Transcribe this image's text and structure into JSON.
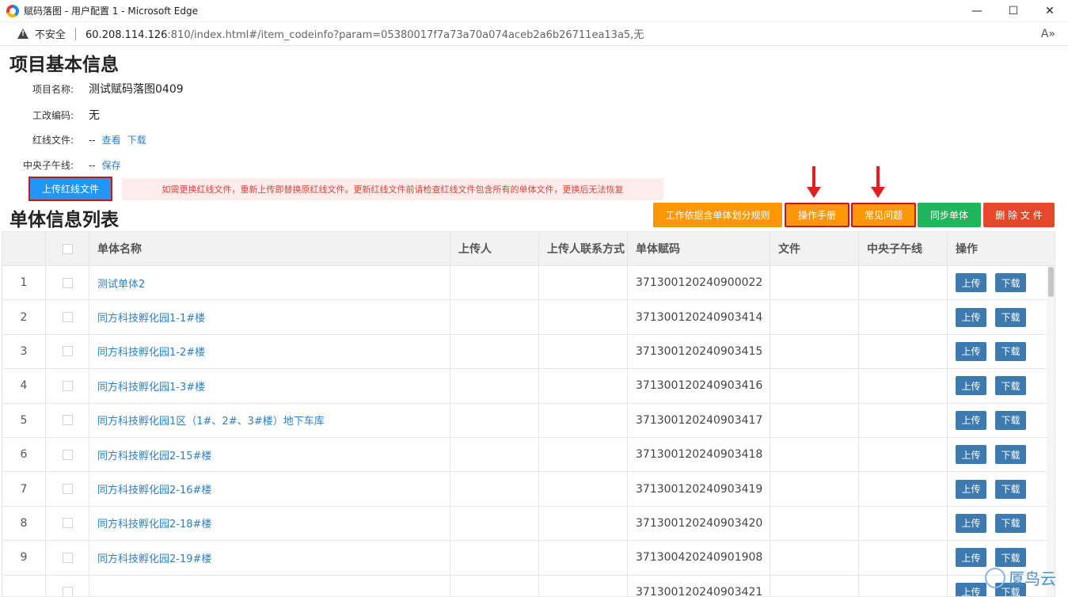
{
  "window": {
    "title": "赋码落图 - 用户配置 1 - Microsoft Edge",
    "minimize": "—",
    "maximize": "☐",
    "close": "✕"
  },
  "address": {
    "insecure_label": "不安全",
    "url_host": "60.208.114.126",
    "url_rest": ":810/index.html#/item_codeinfo?param=05380017f7a73a70a074aceb2a6b26711ea13a5,无",
    "reader_icon": "A»"
  },
  "project": {
    "heading": "项目基本信息",
    "name_label": "项目名称:",
    "name_value": "测试赋码落图0409",
    "code_label": "工改编码:",
    "code_value": "无",
    "redline_label": "红线文件:",
    "redline_dash": "--",
    "view_link": "查看",
    "download_link": "下载",
    "meridian_label": "中央子午线:",
    "meridian_dash": "--",
    "save_link": "保存",
    "upload_redline_label": "上传红线文件",
    "notice_text": "如需更换红线文件，重新上传即替换原红线文件。更新红线文件前请检查红线文件包含所有的单体文件，更换后无法恢复"
  },
  "list": {
    "heading": "单体信息列表",
    "buttons": {
      "rule": "工作依据含单体划分规则",
      "manual": "操作手册",
      "faq": "常见问题",
      "sync": "同步单体",
      "delete": "删 除 文 件"
    },
    "columns": [
      "单体名称",
      "上传人",
      "上传人联系方式",
      "单体赋码",
      "文件",
      "中央子午线",
      "操作"
    ],
    "upload_btn": "上传",
    "download_btn": "下载",
    "rows": [
      {
        "idx": "1",
        "name": "测试单体2",
        "code": "371300120240900022"
      },
      {
        "idx": "2",
        "name": "同方科技孵化园1-1#楼",
        "code": "371300120240903414"
      },
      {
        "idx": "3",
        "name": "同方科技孵化园1-2#楼",
        "code": "371300120240903415"
      },
      {
        "idx": "4",
        "name": "同方科技孵化园1-3#楼",
        "code": "371300120240903416"
      },
      {
        "idx": "5",
        "name": "同方科技孵化园1区（1#、2#、3#楼）地下车库",
        "code": "371300120240903417"
      },
      {
        "idx": "6",
        "name": "同方科技孵化园2-15#楼",
        "code": "371300120240903418"
      },
      {
        "idx": "7",
        "name": "同方科技孵化园2-16#楼",
        "code": "371300120240903419"
      },
      {
        "idx": "8",
        "name": "同方科技孵化园2-18#楼",
        "code": "371300120240903420"
      },
      {
        "idx": "9",
        "name": "同方科技孵化园2-19#楼",
        "code": "371300420240901908"
      },
      {
        "idx": "",
        "name": "",
        "code": "371300120240903421"
      }
    ]
  },
  "watermark": {
    "text": "厦鸟云"
  }
}
